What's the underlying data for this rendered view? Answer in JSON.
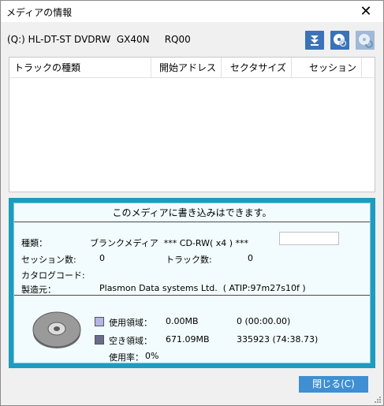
{
  "window": {
    "title": "メディアの情報",
    "close_glyph": "✕"
  },
  "drive": {
    "label": "(Q:) HL-DT-ST DVDRW  GX40N     RQ00"
  },
  "toolbar": {
    "buttons": [
      {
        "icon": "eject-icon",
        "color": "#3a73b8"
      },
      {
        "icon": "disc-search-icon",
        "color": "#3a73b8"
      },
      {
        "icon": "disc-refresh-icon",
        "color": "#9fb9d6"
      }
    ]
  },
  "track_list": {
    "columns": [
      "トラックの種類",
      "開始アドレス",
      "セクタサイズ",
      "セッション"
    ],
    "rows": []
  },
  "media_info": {
    "status": "このメディアに書き込みはできます。",
    "type_label": "種類：",
    "type_value": "ブランクメディア  *** CD-RW( x4 ) ***",
    "sessions_label": "セッション数:",
    "sessions_value": "0",
    "tracks_label": "トラック数:",
    "tracks_value": "0",
    "catalog_label": "カタログコード:",
    "catalog_value": "",
    "maker_label": "製造元：",
    "maker_value": "Plasmon Data systems Ltd.  ( ATIP:97m27s10f )"
  },
  "usage": {
    "used_label": "使用領域：",
    "used_size": "0.00MB",
    "used_sectors": "0 (00:00.00)",
    "free_label": "空き領域：",
    "free_size": "671.09MB",
    "free_sectors": "335923 (74:38.73)",
    "rate_label": "使用率：",
    "rate_value": "0%",
    "used_color": "#b4b4e8",
    "free_color": "#6b6b8e"
  },
  "footer": {
    "close_label": "閉じる(C)"
  },
  "colors": {
    "panel_border": "#1d9cc0",
    "panel_bg": "#f2fbfd",
    "button_blue": "#3f8fd2"
  }
}
